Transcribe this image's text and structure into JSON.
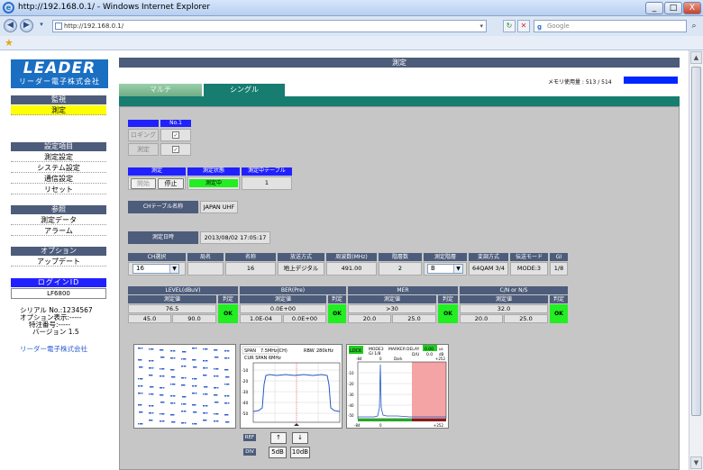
{
  "browser": {
    "title": "http://192.168.0.1/ - Windows Internet Explorer",
    "address": "http://192.168.0.1/",
    "search_placeholder": "Google",
    "minimize": "_",
    "maximize": "□",
    "close": "X"
  },
  "sidebar": {
    "logo_main": "LEADER",
    "logo_sub": "リーダー電子株式会社",
    "sections": [
      {
        "head": "監視",
        "items": [
          "測定"
        ]
      },
      {
        "head": "設定項目",
        "items": [
          "測定設定",
          "システム設定",
          "通信設定",
          "リセット"
        ]
      },
      {
        "head": "参照",
        "items": [
          "測定データ",
          "アラーム"
        ]
      },
      {
        "head": "オプション",
        "items": [
          "アップデート"
        ]
      }
    ],
    "login_head": "ログインID",
    "login_value": "LF6800",
    "serial": "シリアル No.:1234567",
    "option_disp": "オプション表示:-----",
    "special": "特注番号:-----",
    "version": "バージョン 1.5",
    "company_link": "リーダー電子株式会社"
  },
  "main": {
    "header": "測定",
    "memory_label": "メモリ使用量 : 513 / 514",
    "tabs": [
      "マルチ",
      "シングル"
    ],
    "no_header": "No.1",
    "logging_label": "ロギング",
    "measure_label": "測定",
    "check_mark": "✓",
    "meas_headers": [
      "測定",
      "測定状態",
      "測定中テーブル"
    ],
    "start_btn": "開始",
    "stop_btn": "停止",
    "status": "測定中",
    "table_no": "1",
    "ch_table_label": "CHテーブル名称",
    "ch_table_value": "JAPAN UHF",
    "date_label": "測定日時",
    "date_value": "2013/08/02 17:05:17",
    "ch_headers": [
      "CH選択",
      "局名",
      "名称",
      "放送方式",
      "周波数(MHz)",
      "階層数",
      "測定階層",
      "変調方式",
      "伝送モード",
      "GI"
    ],
    "ch_values": [
      "16",
      "",
      "16",
      "地上デジタル",
      "491.00",
      "2",
      "B",
      "64QAM 3/4",
      "MODE:3",
      "1/8"
    ],
    "meter_groups": [
      "LEVEL(dBuV)",
      "BER(Pre)",
      "MER",
      "C/N or N/S"
    ],
    "sub_measured": "測定値",
    "sub_judge": "判定",
    "meters": [
      {
        "value": "76.5",
        "low": "45.0",
        "high": "90.0",
        "judge": "OK"
      },
      {
        "value": "0.0E+00",
        "low": "1.0E-04",
        "high": "0.0E+00",
        "judge": "OK"
      },
      {
        "value": ">30",
        "low": "20.0",
        "high": "25.0",
        "judge": "OK"
      },
      {
        "value": "32.0",
        "low": "20.0",
        "high": "25.0",
        "judge": "OK"
      }
    ],
    "spectrum": {
      "span": "SPAN",
      "span_val": "7.5MHz(CH)",
      "rbw": "RBW",
      "rbw_val": "280kHz",
      "cur_span": "CUR SPAN 6MHz",
      "y_ticks": [
        "-10",
        "-20",
        "-30",
        "-40",
        "-50"
      ]
    },
    "delay_profile": {
      "lock": "LOCK",
      "mode": "MODE3",
      "gi": "GI 1/8",
      "marker": "MARKER",
      "delay": "DELAY",
      "delay_val": "0.00",
      "du": "D/U",
      "du_val": "0.0",
      "db1": "us",
      "db2": "dB",
      "top_label": "-84",
      "top_mid": "0",
      "top_right": "+252",
      "dark": "Dark",
      "y_ticks": [
        "-10",
        "-20",
        "-30",
        "-40",
        "-50"
      ],
      "x_left": "-84",
      "x_mid": "0",
      "x_right": "+252"
    },
    "ref_label": "REF",
    "div_label": "DIV",
    "up_btn": "↑",
    "down_btn": "↓",
    "div5": "5dB",
    "div10": "10dB"
  }
}
